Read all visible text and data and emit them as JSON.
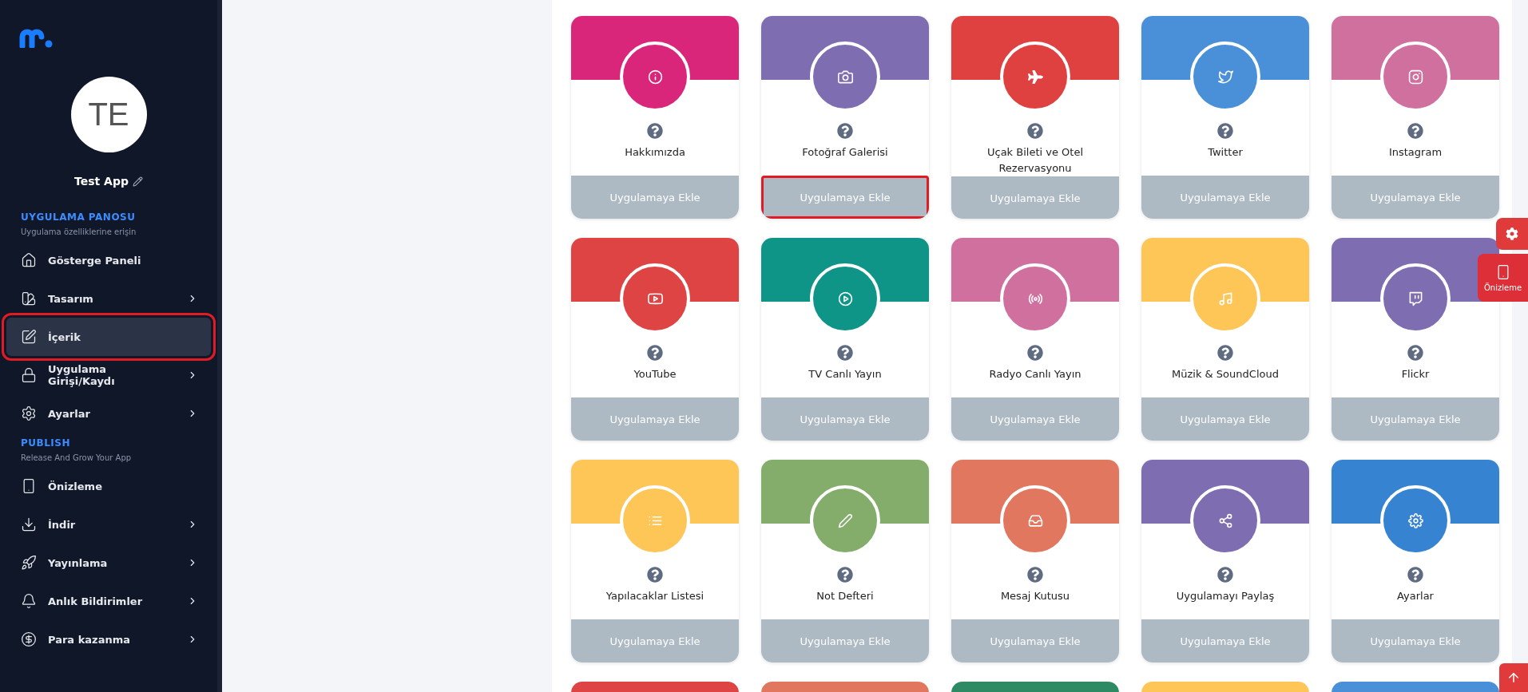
{
  "sidebar": {
    "app": {
      "initials": "TE",
      "name": "Test App"
    },
    "sections": [
      {
        "title": "UYGULAMA PANOSU",
        "subtitle": "Uygulama özelliklerine erişin",
        "items": [
          {
            "label": "Gösterge Paneli",
            "expandable": false,
            "selected": false,
            "highlighted": false
          },
          {
            "label": "Tasarım",
            "expandable": true,
            "selected": false,
            "highlighted": false
          },
          {
            "label": "İçerik",
            "expandable": false,
            "selected": true,
            "highlighted": true
          },
          {
            "label": "Uygulama Girişi/Kaydı",
            "expandable": true,
            "selected": false,
            "highlighted": false
          },
          {
            "label": "Ayarlar",
            "expandable": true,
            "selected": false,
            "highlighted": false
          }
        ]
      },
      {
        "title": "PUBLISH",
        "subtitle": "Release And Grow Your App",
        "items": [
          {
            "label": "Önizleme",
            "expandable": false,
            "selected": false,
            "highlighted": false
          },
          {
            "label": "İndir",
            "expandable": true,
            "selected": false,
            "highlighted": false
          },
          {
            "label": "Yayınlama",
            "expandable": true,
            "selected": false,
            "highlighted": false
          },
          {
            "label": "Anlık Bildirimler",
            "expandable": true,
            "selected": false,
            "highlighted": false
          },
          {
            "label": "Para kazanma",
            "expandable": true,
            "selected": false,
            "highlighted": false
          }
        ]
      }
    ]
  },
  "modules": [
    {
      "kind": "full",
      "title": "Hakkımızda",
      "color": "#d9267a",
      "button": "Uygulamaya Ekle",
      "highlighted": false
    },
    {
      "kind": "full",
      "title": "Fotoğraf Galerisi",
      "color": "#7e6db0",
      "button": "Uygulamaya Ekle",
      "highlighted": true
    },
    {
      "kind": "full",
      "title": "Uçak Bileti ve Otel Rezervasyonu",
      "color": "#df4040",
      "button": "Uygulamaya Ekle",
      "highlighted": false
    },
    {
      "kind": "full",
      "title": "Twitter",
      "color": "#4a90d9",
      "button": "Uygulamaya Ekle",
      "highlighted": false
    },
    {
      "kind": "full",
      "title": "Instagram",
      "color": "#d0709e",
      "button": "Uygulamaya Ekle",
      "highlighted": false
    },
    {
      "kind": "full",
      "title": "YouTube",
      "color": "#df4444",
      "button": "Uygulamaya Ekle",
      "highlighted": false
    },
    {
      "kind": "full",
      "title": "TV Canlı Yayın",
      "color": "#0f9488",
      "button": "Uygulamaya Ekle",
      "highlighted": false
    },
    {
      "kind": "full",
      "title": "Radyo Canlı Yayın",
      "color": "#d0709e",
      "button": "Uygulamaya Ekle",
      "highlighted": false
    },
    {
      "kind": "full",
      "title": "Müzik & SoundCloud",
      "color": "#fec557",
      "button": "Uygulamaya Ekle",
      "highlighted": false
    },
    {
      "kind": "full",
      "title": "Flickr",
      "color": "#7e6db0",
      "button": "Uygulamaya Ekle",
      "highlighted": false
    },
    {
      "kind": "full",
      "title": "Yapılacaklar Listesi",
      "color": "#fec557",
      "button": "Uygulamaya Ekle",
      "highlighted": false
    },
    {
      "kind": "full",
      "title": "Not Defteri",
      "color": "#84ad6c",
      "button": "Uygulamaya Ekle",
      "highlighted": false
    },
    {
      "kind": "full",
      "title": "Mesaj Kutusu",
      "color": "#e27760",
      "button": "Uygulamaya Ekle",
      "highlighted": false
    },
    {
      "kind": "full",
      "title": "Uygulamayı Paylaş",
      "color": "#7e6db0",
      "button": "Uygulamaya Ekle",
      "highlighted": false
    },
    {
      "kind": "full",
      "title": "Ayarlar",
      "color": "#3583d1",
      "button": "Uygulamaya Ekle",
      "highlighted": false
    },
    {
      "kind": "peek",
      "color": "#df4444"
    },
    {
      "kind": "peek",
      "color": "#e27760"
    },
    {
      "kind": "peek",
      "color": "#2e8a63"
    },
    {
      "kind": "peek",
      "color": "#fec557"
    },
    {
      "kind": "peek",
      "color": "#4a90d9"
    }
  ],
  "floating": {
    "preview_label": "Önizleme"
  }
}
